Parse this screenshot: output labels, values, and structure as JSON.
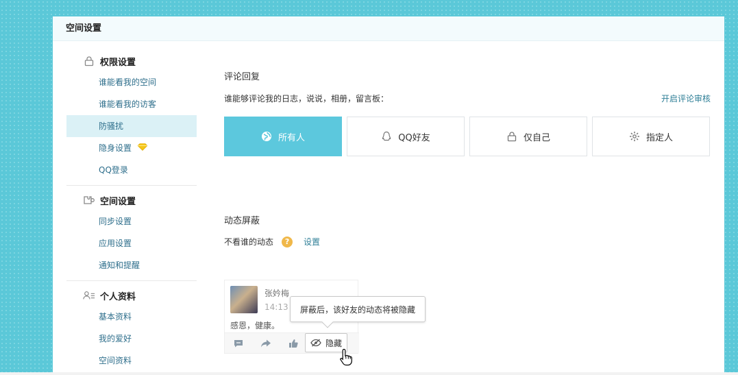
{
  "panel": {
    "title": "空间设置"
  },
  "sidebar": {
    "sections": [
      {
        "title": "权限设置",
        "icon": "lock-icon",
        "items": [
          "谁能看我的空间",
          "谁能看我的访客",
          "防骚扰",
          "隐身设置",
          "QQ登录"
        ]
      },
      {
        "title": "空间设置",
        "icon": "puzzle-icon",
        "items": [
          "同步设置",
          "应用设置",
          "通知和提醒"
        ]
      },
      {
        "title": "个人资料",
        "icon": "profile-icon",
        "items": [
          "基本资料",
          "我的爱好",
          "空间资料"
        ]
      }
    ],
    "active_item": "防骚扰"
  },
  "comment_reply": {
    "title": "评论回复",
    "description": "谁能够评论我的日志，说说，相册，留言板：",
    "audit_link": "开启评论审核",
    "options": [
      {
        "label": "所有人",
        "icon": "globe-icon",
        "selected": true
      },
      {
        "label": "QQ好友",
        "icon": "qq-penguin-icon",
        "selected": false
      },
      {
        "label": "仅自己",
        "icon": "lock-icon",
        "selected": false
      },
      {
        "label": "指定人",
        "icon": "gear-icon",
        "selected": false
      }
    ]
  },
  "feed_block": {
    "title": "动态屏蔽",
    "label": "不看谁的动态",
    "help": "?",
    "set_link": "设置",
    "demo": {
      "name": "张妗梅",
      "time": "14:13",
      "text": "感恩，健康。",
      "hide_label": "隐藏",
      "tooltip": "屏蔽后，该好友的动态将被隐藏"
    }
  },
  "colors": {
    "accent": "#5cc8dd",
    "link": "#2f7f97",
    "background": "#5bc8d8"
  }
}
